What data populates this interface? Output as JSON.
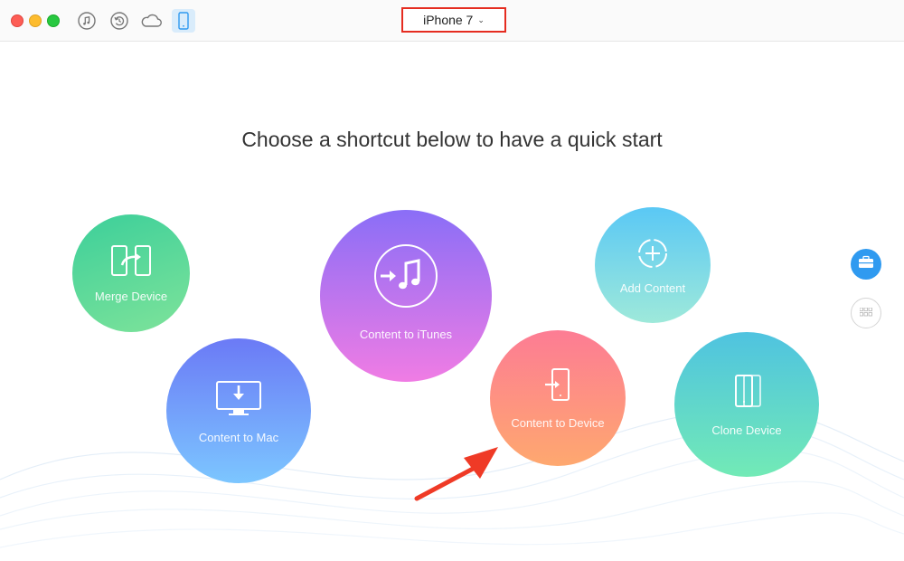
{
  "toolbar": {
    "tools": [
      {
        "icon": "music-note-icon"
      },
      {
        "icon": "restore-icon"
      },
      {
        "icon": "cloud-icon"
      },
      {
        "icon": "phone-icon",
        "active": true
      }
    ],
    "device_name": "iPhone 7",
    "device_chevron": "⌄"
  },
  "main": {
    "headline": "Choose a shortcut below to have a quick start",
    "shortcuts": [
      {
        "label": "Merge Device",
        "icon": "merge-device-icon"
      },
      {
        "label": "Content to Mac",
        "icon": "computer-download-icon"
      },
      {
        "label": "Content to iTunes",
        "icon": "itunes-transfer-icon"
      },
      {
        "label": "Content to Device",
        "icon": "phone-import-icon"
      },
      {
        "label": "Add Content",
        "icon": "add-circle-icon"
      },
      {
        "label": "Clone Device",
        "icon": "clone-device-icon"
      }
    ]
  },
  "sidebar": {
    "buttons": [
      {
        "icon": "toolkit-icon",
        "active": true
      },
      {
        "icon": "apps-grid-icon"
      }
    ]
  },
  "colors": {
    "accent": "#2f9af0",
    "highlight_red": "#e52c20",
    "active_tool_bg": "#d9ecfb"
  }
}
